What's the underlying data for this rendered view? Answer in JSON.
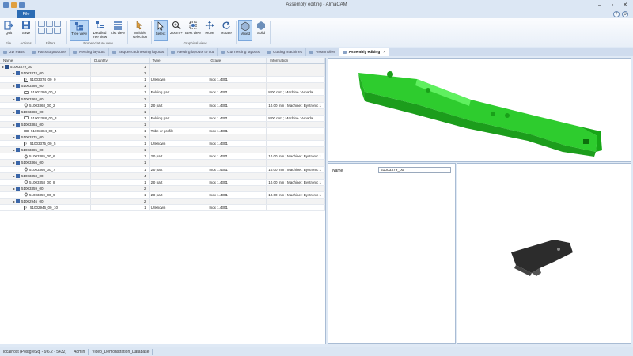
{
  "window": {
    "title": "Assembly editing - AlmaCAM"
  },
  "ribbon_tabs": [
    {
      "label": "File"
    }
  ],
  "ribbon": {
    "quit": "Quit",
    "save": "Save",
    "tree_view": "Tree view",
    "detailed_tree_view": "Detailed tree view",
    "list_view": "List view",
    "multiple_selection": "Multiple selection",
    "select": "Select",
    "zoom_plus": "Zoom +",
    "best_view": "Best view",
    "move": "Move",
    "rotate": "Rotate",
    "mixed": "Mixed",
    "solid": "Solid",
    "groups": {
      "file": "File",
      "actions": "Actions",
      "filters": "Filters",
      "nomenclature_view": "Nomenclature view",
      "graphical_view": "Graphical view"
    }
  },
  "doc_tabs": [
    {
      "label": "2D Parts"
    },
    {
      "label": "Parts to produce"
    },
    {
      "label": "Nesting layouts"
    },
    {
      "label": "Sequenced nesting layouts"
    },
    {
      "label": "Nesting layouts to cut"
    },
    {
      "label": "Cut nesting layouts"
    },
    {
      "label": "Cutting machines"
    },
    {
      "label": "Assemblies"
    },
    {
      "label": "Assembly editing",
      "close": "×"
    }
  ],
  "table": {
    "columns": [
      "Name",
      "Quantity",
      "Type",
      "Grade",
      "Information"
    ],
    "rows": [
      {
        "name": "51003379_00",
        "qty": "1",
        "type": "",
        "grade": "",
        "info": ""
      },
      {
        "name": "51003374_00",
        "qty": "2",
        "type": "",
        "grade": "",
        "info": ""
      },
      {
        "name": "51003374_00_0",
        "qty": "1",
        "type": "Unknown",
        "grade": "Inox 1.4301",
        "info": ""
      },
      {
        "name": "51003386_00",
        "qty": "1",
        "type": "",
        "grade": "",
        "info": ""
      },
      {
        "name": "51003386_00_1",
        "qty": "1",
        "type": "Folding part",
        "grade": "Inox 1.4301",
        "info": "8.00 mm ; Machine : Amada"
      },
      {
        "name": "51003368_00",
        "qty": "2",
        "type": "",
        "grade": "",
        "info": ""
      },
      {
        "name": "51003368_00_2",
        "qty": "1",
        "type": "2D part",
        "grade": "Inox 1.4301",
        "info": "10.00 mm ; Machine : Bystronic 1"
      },
      {
        "name": "51003388_00",
        "qty": "1",
        "type": "",
        "grade": "",
        "info": ""
      },
      {
        "name": "51003388_00_3",
        "qty": "1",
        "type": "Folding part",
        "grade": "Inox 1.4301",
        "info": "8.00 mm ; Machine : Amada"
      },
      {
        "name": "51003384_00",
        "qty": "1",
        "type": "",
        "grade": "",
        "info": ""
      },
      {
        "name": "51003384_00_4",
        "qty": "1",
        "type": "Tube or profile",
        "grade": "Inox 1.4301",
        "info": ""
      },
      {
        "name": "51003375_00",
        "qty": "2",
        "type": "",
        "grade": "",
        "info": ""
      },
      {
        "name": "51003375_00_5",
        "qty": "1",
        "type": "Unknown",
        "grade": "Inox 1.4301",
        "info": ""
      },
      {
        "name": "51003385_00",
        "qty": "1",
        "type": "",
        "grade": "",
        "info": ""
      },
      {
        "name": "51003385_00_6",
        "qty": "1",
        "type": "2D part",
        "grade": "Inox 1.4301",
        "info": "10.00 mm ; Machine : Bystronic 1"
      },
      {
        "name": "51003366_00",
        "qty": "1",
        "type": "",
        "grade": "",
        "info": ""
      },
      {
        "name": "51003366_00_7",
        "qty": "1",
        "type": "2D part",
        "grade": "Inox 1.4301",
        "info": "10.00 mm ; Machine : Bystronic 1"
      },
      {
        "name": "51003358_00",
        "qty": "4",
        "type": "",
        "grade": "",
        "info": ""
      },
      {
        "name": "51003358_00_8",
        "qty": "1",
        "type": "2D part",
        "grade": "Inox 1.4301",
        "info": "10.00 mm ; Machine : Bystronic 1"
      },
      {
        "name": "51003359_00",
        "qty": "2",
        "type": "",
        "grade": "",
        "info": ""
      },
      {
        "name": "51003359_00_9",
        "qty": "1",
        "type": "2D part",
        "grade": "Inox 1.4301",
        "info": "10.00 mm ; Machine : Bystronic 1"
      },
      {
        "name": "51002946_00",
        "qty": "2",
        "type": "",
        "grade": "",
        "info": ""
      },
      {
        "name": "51002946_00_10",
        "qty": "1",
        "type": "Unknown",
        "grade": "Inox 1.4301",
        "info": ""
      }
    ]
  },
  "properties": {
    "name_label": "Name",
    "name_value": "51003379_00"
  },
  "status": {
    "connection": "localhost (PostgreSql - 9.6.2 - 5432)",
    "user": "Admin",
    "database": "Video_Demonstration_Database"
  },
  "colors": {
    "accent": "#2b6cb4",
    "part_green": "#2ee02e",
    "part_dark": "#2a2a2a"
  }
}
